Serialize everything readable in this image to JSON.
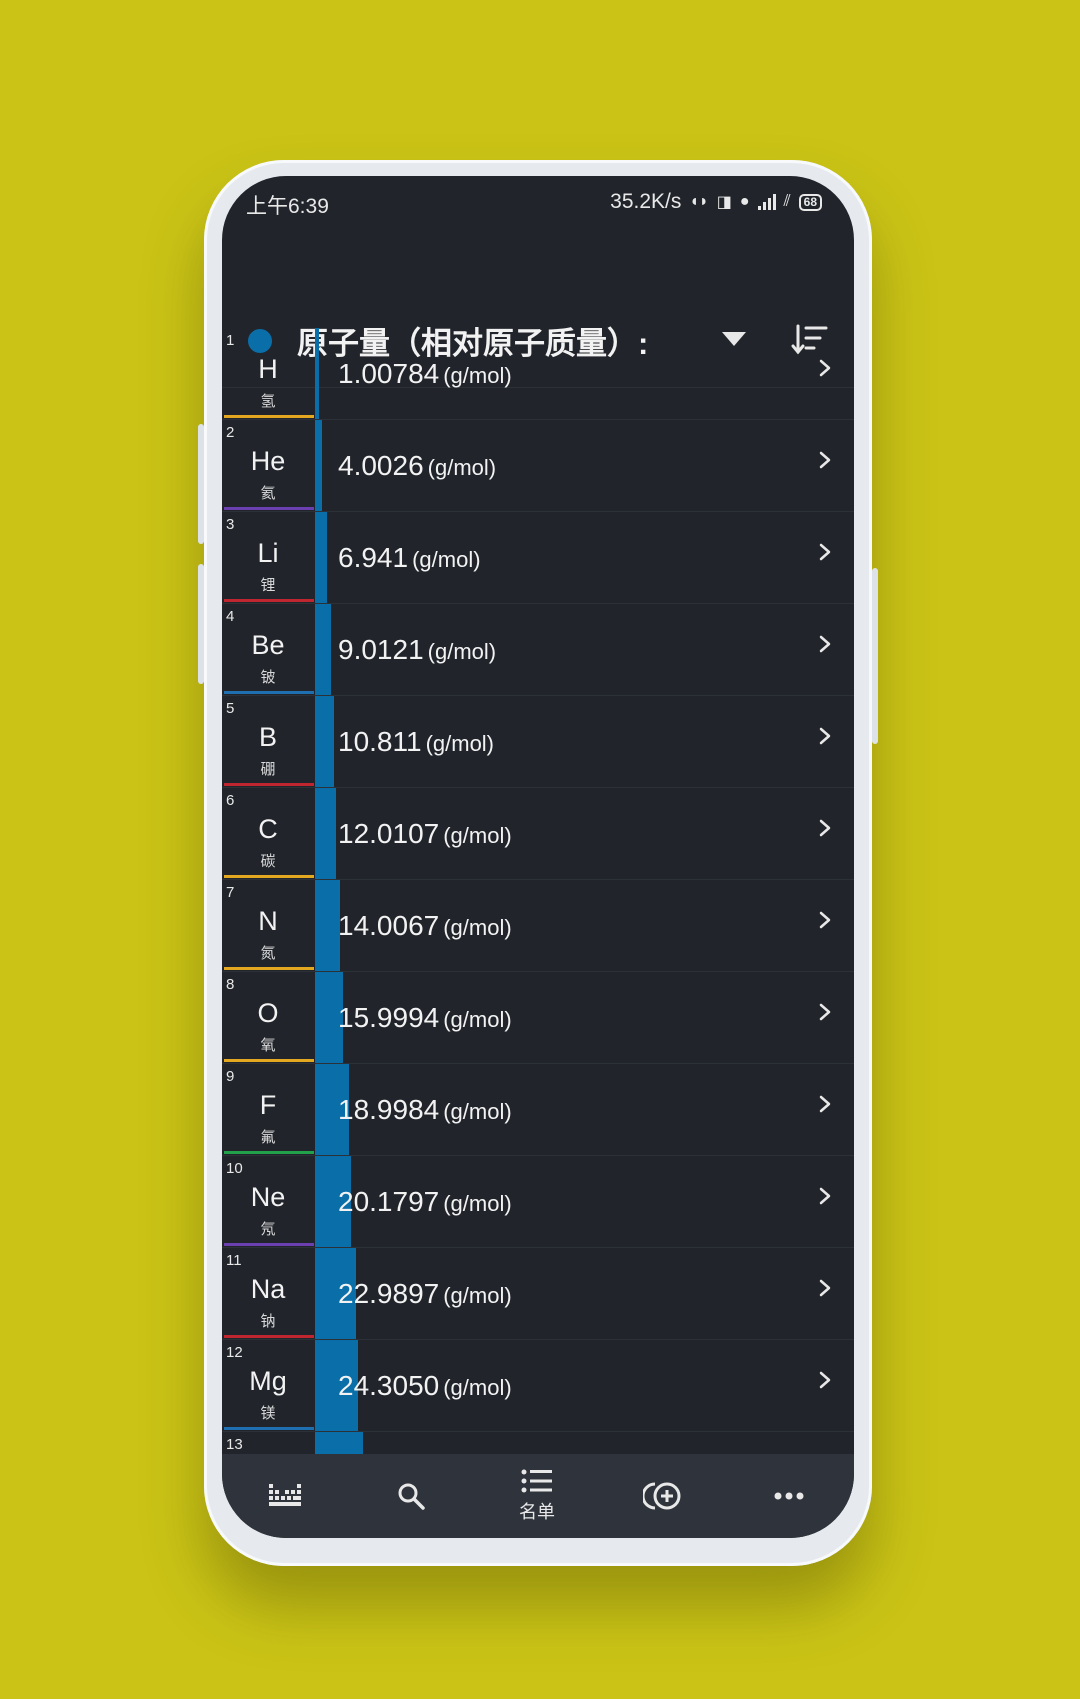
{
  "status_bar": {
    "time": "上午6:39",
    "speed": "35.2K/s",
    "battery": "68"
  },
  "toolbar": {
    "title": "原子量（相对原子质量）:",
    "accent_color": "#0a6ea9"
  },
  "unit": "(g/mol)",
  "elements": [
    {
      "number": "1",
      "symbol": "H",
      "name": "氢",
      "value": "1.00784",
      "category_color": "#e3a820",
      "bar": 1.00784
    },
    {
      "number": "2",
      "symbol": "He",
      "name": "氦",
      "value": "4.0026",
      "category_color": "#6b3fb0",
      "bar": 4.0026
    },
    {
      "number": "3",
      "symbol": "Li",
      "name": "锂",
      "value": "6.941",
      "category_color": "#c0262f",
      "bar": 6.941
    },
    {
      "number": "4",
      "symbol": "Be",
      "name": "铍",
      "value": "9.0121",
      "category_color": "#1f6fb0",
      "bar": 9.0121
    },
    {
      "number": "5",
      "symbol": "B",
      "name": "硼",
      "value": "10.811",
      "category_color": "#c0262f",
      "bar": 10.811
    },
    {
      "number": "6",
      "symbol": "C",
      "name": "碳",
      "value": "12.0107",
      "category_color": "#e3a820",
      "bar": 12.0107
    },
    {
      "number": "7",
      "symbol": "N",
      "name": "氮",
      "value": "14.0067",
      "category_color": "#e3a820",
      "bar": 14.0067
    },
    {
      "number": "8",
      "symbol": "O",
      "name": "氧",
      "value": "15.9994",
      "category_color": "#e3a820",
      "bar": 15.9994
    },
    {
      "number": "9",
      "symbol": "F",
      "name": "氟",
      "value": "18.9984",
      "category_color": "#23a04a",
      "bar": 18.9984
    },
    {
      "number": "10",
      "symbol": "Ne",
      "name": "氖",
      "value": "20.1797",
      "category_color": "#6b3fb0",
      "bar": 20.1797
    },
    {
      "number": "11",
      "symbol": "Na",
      "name": "钠",
      "value": "22.9897",
      "category_color": "#c0262f",
      "bar": 22.9897
    },
    {
      "number": "12",
      "symbol": "Mg",
      "name": "镁",
      "value": "24.3050",
      "category_color": "#1f6fb0",
      "bar": 24.305
    },
    {
      "number": "13",
      "symbol": "",
      "name": "",
      "value": "",
      "category_color": "#c0262f",
      "bar": 26.9815
    }
  ],
  "bottom_nav": {
    "items": [
      {
        "icon": "periodic-table-icon",
        "label": ""
      },
      {
        "icon": "search-icon",
        "label": ""
      },
      {
        "icon": "list-icon",
        "label": "名单"
      },
      {
        "icon": "add-compare-icon",
        "label": ""
      },
      {
        "icon": "more-icon",
        "label": ""
      }
    ]
  }
}
